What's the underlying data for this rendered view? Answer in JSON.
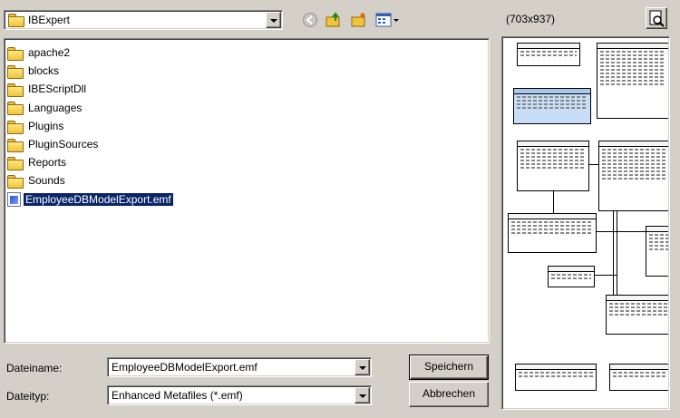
{
  "toolbar": {
    "location": "IBExpert",
    "back_icon": "back-arrow-icon",
    "up_icon": "up-folder-icon",
    "new_folder_icon": "new-folder-icon",
    "view_icon": "view-menu-icon"
  },
  "files": [
    {
      "name": "apache2",
      "type": "folder"
    },
    {
      "name": "blocks",
      "type": "folder"
    },
    {
      "name": "IBEScriptDll",
      "type": "folder"
    },
    {
      "name": "Languages",
      "type": "folder"
    },
    {
      "name": "Plugins",
      "type": "folder"
    },
    {
      "name": "PluginSources",
      "type": "folder"
    },
    {
      "name": "Reports",
      "type": "folder"
    },
    {
      "name": "Sounds",
      "type": "folder"
    },
    {
      "name": "EmployeeDBModelExport.emf",
      "type": "emf",
      "selected": true
    }
  ],
  "form": {
    "filename_label": "Dateiname:",
    "filename_value": "EmployeeDBModelExport.emf",
    "filetype_label": "Dateityp:",
    "filetype_value": "Enhanced Metafiles (*.emf)",
    "save_button": "Speichern",
    "cancel_button": "Abbrechen"
  },
  "preview": {
    "dimensions": "(703x937)",
    "preview_icon": "preview-magnifier-icon"
  },
  "colors": {
    "dialog_bg": "#d4d0c8",
    "selection": "#0a246a",
    "folder": "#f2c438"
  }
}
